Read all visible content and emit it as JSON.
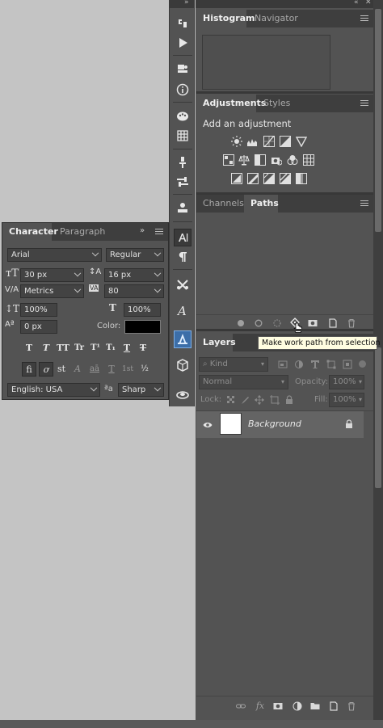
{
  "dock_top": {
    "expand_icon": "»",
    "collapse_icon": "«"
  },
  "histogram_panel": {
    "tabs": [
      "Histogram",
      "Navigator"
    ],
    "active_tab": "Histogram"
  },
  "adjustments_panel": {
    "tabs": [
      "Adjustments",
      "Styles"
    ],
    "active_tab": "Adjustments",
    "heading": "Add an adjustment",
    "icons_row1": [
      "brightness-contrast-icon",
      "levels-icon",
      "curves-icon",
      "exposure-icon",
      "vibrance-icon"
    ],
    "icons_row2": [
      "hue-saturation-icon",
      "color-balance-icon",
      "black-white-icon",
      "photo-filter-icon",
      "channel-mixer-icon",
      "color-lookup-icon"
    ],
    "icons_row3": [
      "invert-icon",
      "posterize-icon",
      "threshold-icon",
      "selective-color-icon",
      "gradient-map-icon"
    ]
  },
  "paths_panel": {
    "tabs": [
      "Channels",
      "Paths"
    ],
    "active_tab": "Paths",
    "footer_icons": [
      "fill-path-icon",
      "stroke-path-icon",
      "load-selection-icon",
      "make-work-path-icon",
      "add-mask-icon",
      "new-path-icon",
      "delete-path-icon"
    ],
    "tooltip": "Make work path from selection"
  },
  "layers_panel": {
    "tabs": [
      "Layers"
    ],
    "active_tab": "Layers",
    "filter_kind": "Kind",
    "blend_mode": "Normal",
    "opacity_label": "Opacity:",
    "opacity_value": "100%",
    "lock_label": "Lock:",
    "fill_label": "Fill:",
    "fill_value": "100%",
    "layers": [
      {
        "name": "Background",
        "visible": true,
        "locked": true
      }
    ],
    "footer_icons": [
      "link-layers-icon",
      "fx-icon",
      "layer-mask-icon",
      "adjustment-layer-icon",
      "group-icon",
      "new-layer-icon",
      "delete-layer-icon"
    ]
  },
  "character_panel": {
    "tabs": [
      "Character",
      "Paragraph"
    ],
    "active_tab": "Character",
    "font_family": "Arial",
    "font_style": "Regular",
    "font_size": "30 px",
    "leading": "16 px",
    "kerning": "Metrics",
    "tracking": "80",
    "vertical_scale": "100%",
    "horizontal_scale": "100%",
    "baseline_shift": "0 px",
    "color_label": "Color:",
    "color_value": "#000000",
    "type_styles": [
      "T",
      "T",
      "TT",
      "Tr",
      "T¹",
      "T₁",
      "T",
      "T"
    ],
    "opentype_features": [
      "fi",
      "ơ",
      "st",
      "A",
      "aā",
      "T",
      "1st",
      "½"
    ],
    "language": "English: USA",
    "aa_label": "ªa",
    "antialias": "Sharp"
  },
  "colors": {
    "background": "#c4c4c4",
    "panel": "#535353",
    "tabbar": "#3e3e3e",
    "active_tool": "#3c6ea8",
    "tooltip_bg": "#fffde1"
  }
}
